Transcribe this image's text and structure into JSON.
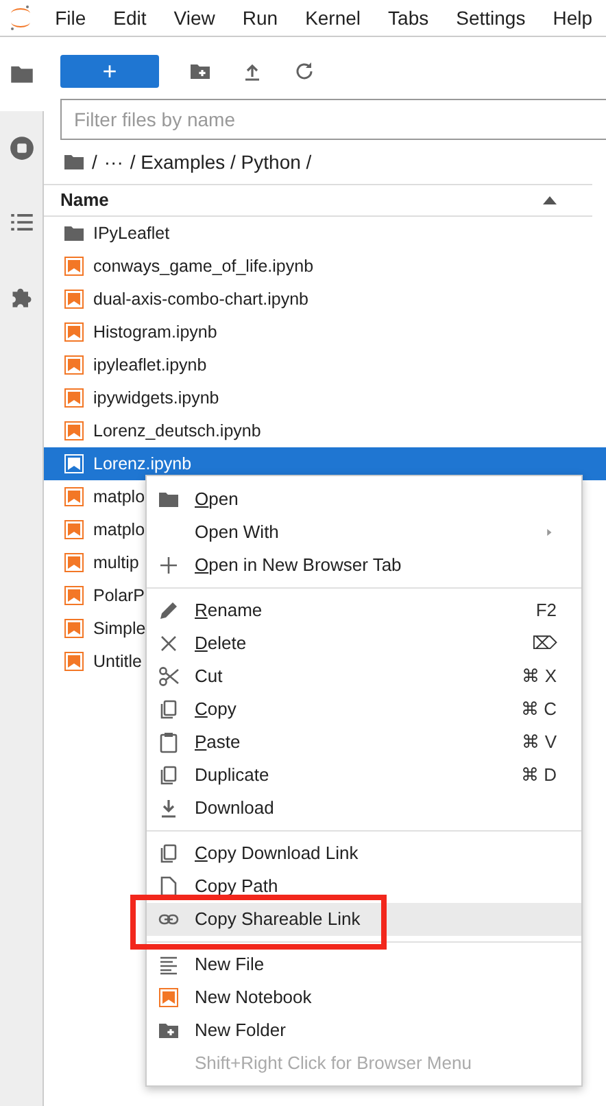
{
  "menubar": [
    "File",
    "Edit",
    "View",
    "Run",
    "Kernel",
    "Tabs",
    "Settings",
    "Help"
  ],
  "sidebar": [
    {
      "selected": true
    },
    {
      "selected": false
    },
    {
      "selected": false
    },
    {
      "selected": false
    }
  ],
  "toolbar": {
    "new_button": "+"
  },
  "filter": {
    "placeholder": "Filter files by name"
  },
  "breadcrumb": [
    "/",
    "···",
    "/ Examples / Python /"
  ],
  "table": {
    "columns": [
      "Name"
    ],
    "rows": [
      {
        "kind": "folder",
        "name": "IPyLeaflet",
        "selected": false
      },
      {
        "kind": "notebook",
        "name": "conways_game_of_life.ipynb",
        "selected": false
      },
      {
        "kind": "notebook",
        "name": "dual-axis-combo-chart.ipynb",
        "selected": false
      },
      {
        "kind": "notebook",
        "name": "Histogram.ipynb",
        "selected": false
      },
      {
        "kind": "notebook",
        "name": "ipyleaflet.ipynb",
        "selected": false
      },
      {
        "kind": "notebook",
        "name": "ipywidgets.ipynb",
        "selected": false
      },
      {
        "kind": "notebook",
        "name": "Lorenz_deutsch.ipynb",
        "selected": false
      },
      {
        "kind": "notebook",
        "name": "Lorenz.ipynb",
        "selected": true
      },
      {
        "kind": "notebook",
        "name": "matplo",
        "selected": false
      },
      {
        "kind": "notebook",
        "name": "matplo",
        "selected": false
      },
      {
        "kind": "notebook",
        "name": "multip",
        "selected": false
      },
      {
        "kind": "notebook",
        "name": "PolarP",
        "selected": false
      },
      {
        "kind": "notebook",
        "name": "Simple",
        "selected": false
      },
      {
        "kind": "notebook",
        "name": "Untitle",
        "selected": false
      }
    ]
  },
  "context_menu": [
    {
      "kind": "item",
      "label": "Open",
      "mnemonic": true
    },
    {
      "kind": "item",
      "label": "Open With",
      "submenu": true
    },
    {
      "kind": "item",
      "label": "Open in New Browser Tab",
      "mnemonic": true
    },
    {
      "kind": "separator"
    },
    {
      "kind": "item",
      "label": "Rename",
      "mnemonic": true,
      "shortcut": "F2"
    },
    {
      "kind": "item",
      "label": "Delete",
      "mnemonic": true,
      "shortcut": "⌦"
    },
    {
      "kind": "item",
      "label": "Cut",
      "shortcut": "⌘ X"
    },
    {
      "kind": "item",
      "label": "Copy",
      "mnemonic": true,
      "shortcut": "⌘ C"
    },
    {
      "kind": "item",
      "label": "Paste",
      "mnemonic": true,
      "shortcut": "⌘ V"
    },
    {
      "kind": "item",
      "label": "Duplicate",
      "shortcut": "⌘ D"
    },
    {
      "kind": "item",
      "label": "Download"
    },
    {
      "kind": "separator"
    },
    {
      "kind": "item",
      "label": "Copy Download Link",
      "mnemonic": true
    },
    {
      "kind": "item",
      "label": "Copy Path"
    },
    {
      "kind": "item",
      "label": "Copy Shareable Link",
      "hovered": true,
      "annotated": true
    },
    {
      "kind": "separator"
    },
    {
      "kind": "item",
      "label": "New File"
    },
    {
      "kind": "item",
      "label": "New Notebook"
    },
    {
      "kind": "item",
      "label": "New Folder"
    },
    {
      "kind": "hint",
      "label": "Shift+Right Click for Browser Menu"
    }
  ]
}
